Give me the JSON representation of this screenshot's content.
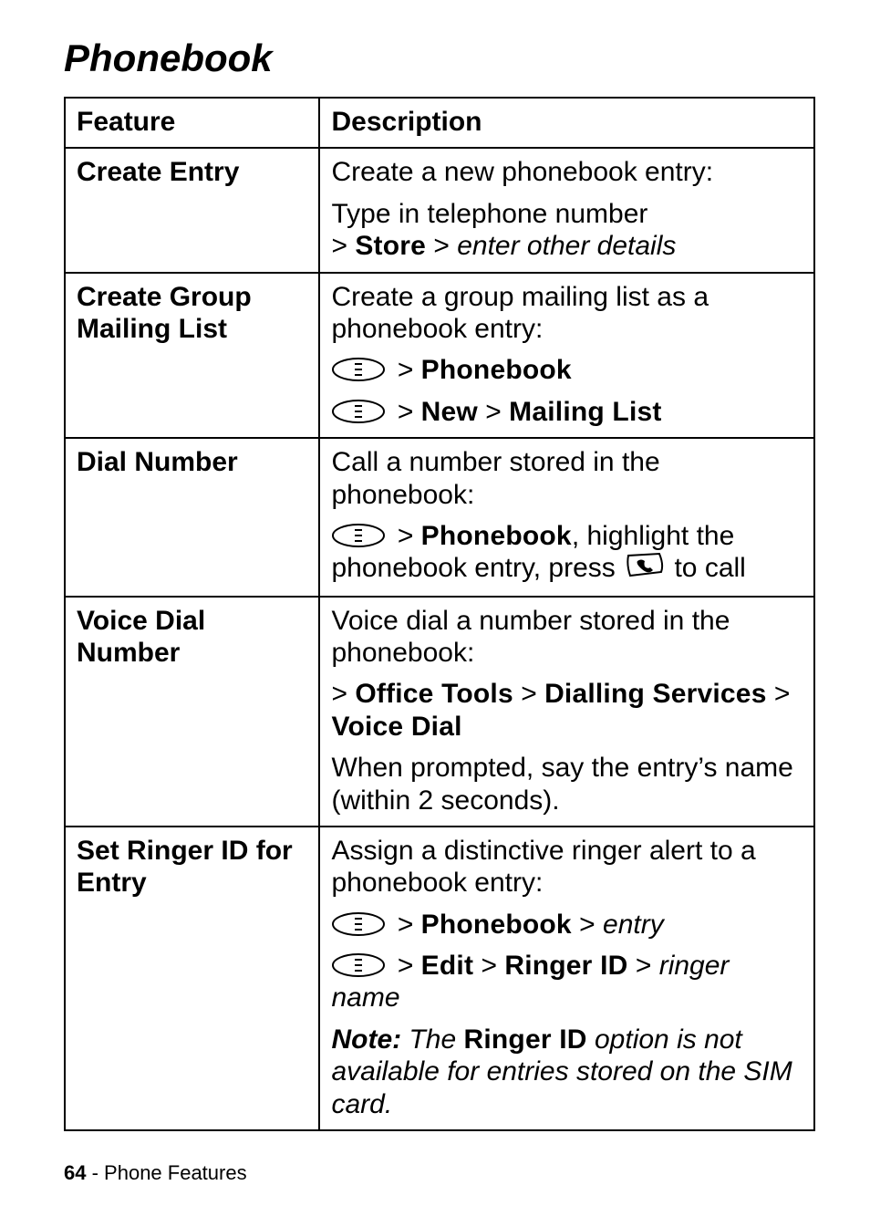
{
  "section_title": "Phonebook",
  "table": {
    "headers": {
      "feature": "Feature",
      "description": "Description"
    },
    "rows": [
      {
        "feature": "Create Entry",
        "blocks": [
          {
            "type": "plain",
            "text": "Create a new phonebook entry:"
          },
          {
            "type": "type_store",
            "line1": "Type in telephone number",
            "gt": ">",
            "store": "Store",
            "gt2": ">",
            "rest": "enter other details"
          }
        ]
      },
      {
        "feature": "Create Group Mailing List",
        "blocks": [
          {
            "type": "plain",
            "text": "Create a group mailing list as a phonebook entry:"
          },
          {
            "type": "menu_path",
            "parts": [
              {
                "kind": "icon"
              },
              {
                "kind": "gt",
                "t": ">"
              },
              {
                "kind": "cond",
                "t": "Phonebook"
              }
            ]
          },
          {
            "type": "menu_path",
            "parts": [
              {
                "kind": "icon"
              },
              {
                "kind": "gt",
                "t": ">"
              },
              {
                "kind": "cond",
                "t": "New"
              },
              {
                "kind": "gt",
                "t": ">"
              },
              {
                "kind": "cond",
                "t": "Mailing List"
              }
            ]
          }
        ]
      },
      {
        "feature": "Dial Number",
        "blocks": [
          {
            "type": "plain",
            "text": "Call a number stored in the phonebook:"
          },
          {
            "type": "dial_instruction",
            "pre_icon": true,
            "gt": ">",
            "phonebook": "Phonebook",
            "after": ", highlight the phonebook entry, press ",
            "phone_icon": true,
            "tail": " to call"
          }
        ]
      },
      {
        "feature": "Voice Dial Number",
        "blocks": [
          {
            "type": "plain",
            "text": "Voice dial a number stored in the phonebook:"
          },
          {
            "type": "menu_path_noicon",
            "parts": [
              {
                "kind": "gt",
                "t": ">"
              },
              {
                "kind": "cond",
                "t": "Office Tools"
              },
              {
                "kind": "gt",
                "t": ">"
              },
              {
                "kind": "cond",
                "t": "Dialling Services"
              },
              {
                "kind": "gt",
                "t": ">"
              },
              {
                "kind": "cond",
                "t": "Voice Dial"
              }
            ]
          },
          {
            "type": "plain",
            "text": "When prompted, say the entry’s name (within 2 seconds)."
          }
        ]
      },
      {
        "feature": "Set Ringer ID for Entry",
        "blocks": [
          {
            "type": "plain",
            "text": "Assign a distinctive ringer alert to a phonebook entry:"
          },
          {
            "type": "menu_path",
            "parts": [
              {
                "kind": "icon"
              },
              {
                "kind": "gt",
                "t": ">"
              },
              {
                "kind": "cond",
                "t": "Phonebook"
              },
              {
                "kind": "gt",
                "t": ">"
              },
              {
                "kind": "ital",
                "t": "entry"
              }
            ]
          },
          {
            "type": "menu_path",
            "parts": [
              {
                "kind": "icon"
              },
              {
                "kind": "gt",
                "t": ">"
              },
              {
                "kind": "cond",
                "t": "Edit"
              },
              {
                "kind": "gt",
                "t": ">"
              },
              {
                "kind": "cond",
                "t": "Ringer ID"
              },
              {
                "kind": "gt",
                "t": ">"
              },
              {
                "kind": "ital",
                "t": "ringer name"
              }
            ]
          },
          {
            "type": "note",
            "note_label": "Note:",
            "before": " The ",
            "ringer_id": "Ringer ID",
            "after": " option is not available for entries stored on the SIM card."
          }
        ]
      }
    ]
  },
  "footer": {
    "page": "64",
    "sep": " - ",
    "section": "Phone Features"
  }
}
